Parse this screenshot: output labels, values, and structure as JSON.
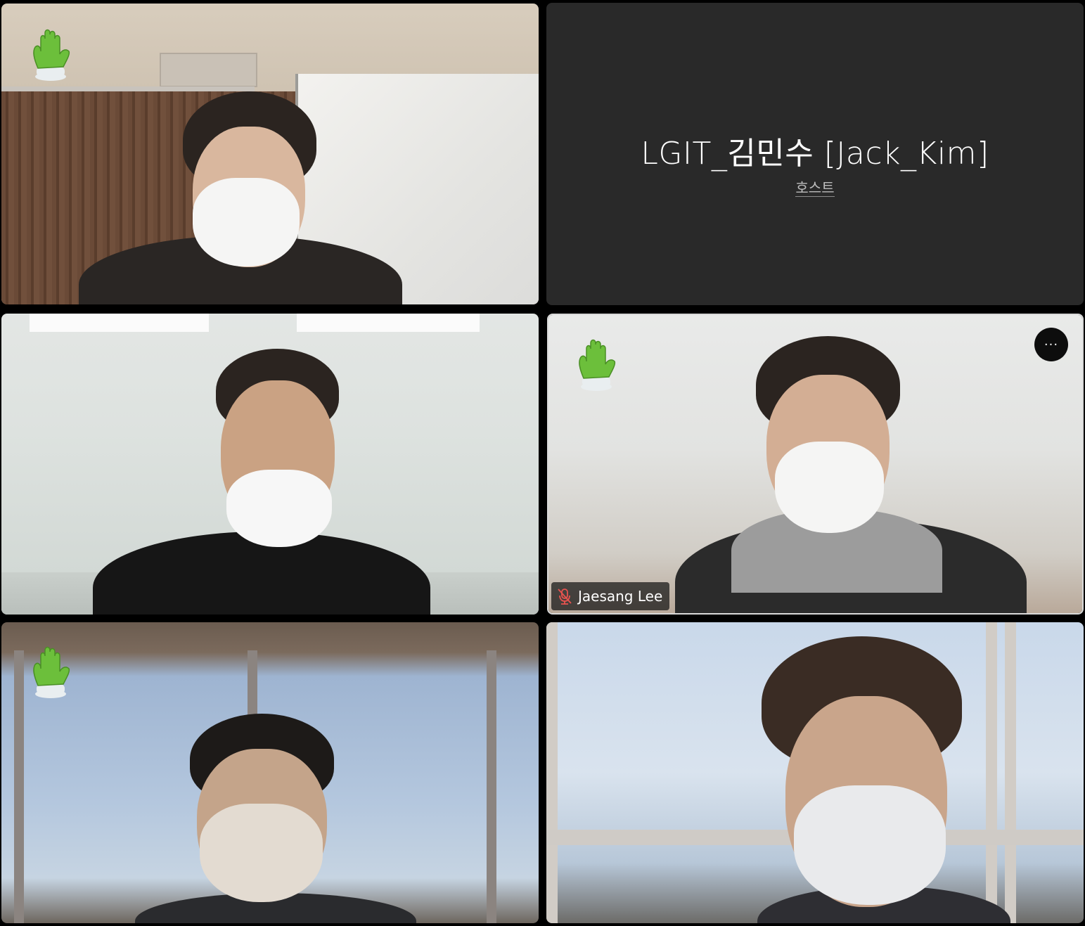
{
  "window": {
    "background": "#000000"
  },
  "host_tile": {
    "name": "LGIT_김민수 [Jack_Kim]",
    "role": "호스트"
  },
  "participants": [
    {
      "tile": 1,
      "raised_hand": true,
      "video": true
    },
    {
      "tile": 3,
      "raised_hand": false,
      "video": true
    },
    {
      "tile": 4,
      "raised_hand": true,
      "video": true,
      "name": "Jaesang Lee",
      "muted": true,
      "active_speaker_border": true,
      "more_button_label": "···"
    },
    {
      "tile": 5,
      "raised_hand": true,
      "video": true
    },
    {
      "tile": 6,
      "raised_hand": false,
      "video": true
    }
  ],
  "colors": {
    "hand_green": "#6cbf3b",
    "hand_cuff": "#e9eef0",
    "mute_red": "#e8534f",
    "host_tile_bg": "#292929"
  },
  "icons": {
    "raised_hand": "raised-hand-icon",
    "mic_off": "microphone-off-icon",
    "more": "more-options-icon"
  }
}
